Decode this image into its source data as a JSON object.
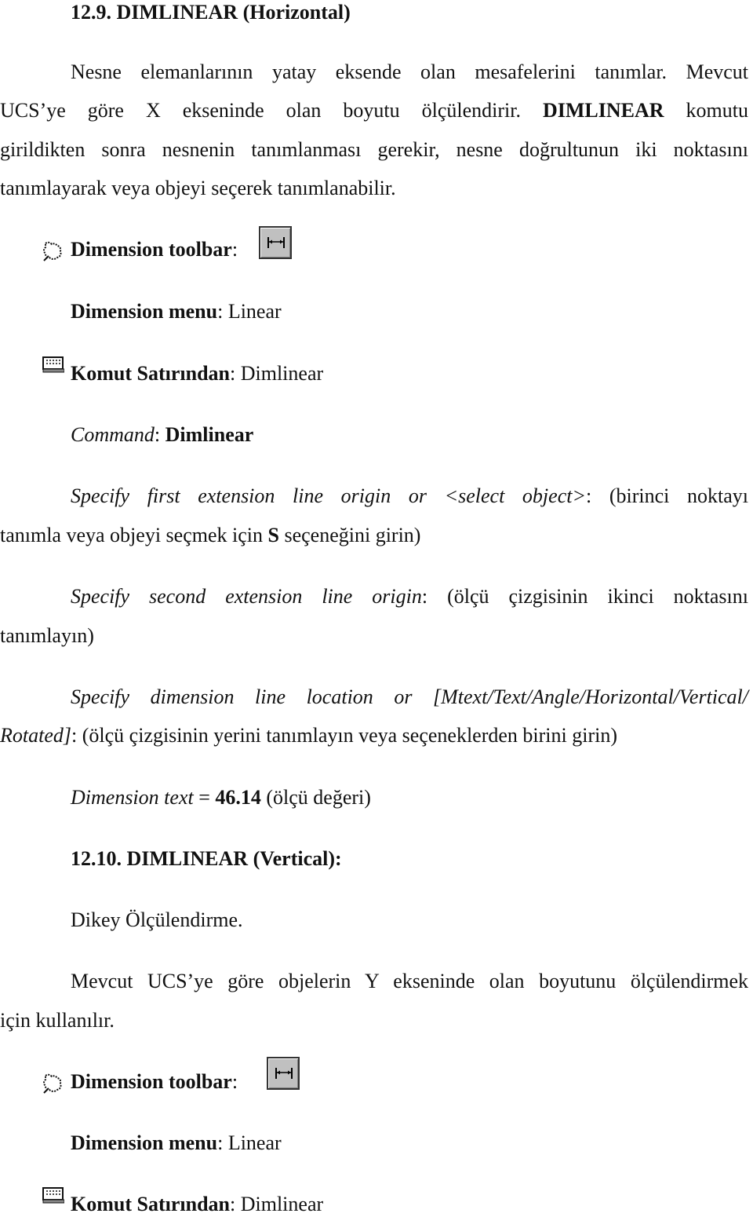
{
  "section1": {
    "heading": "12.9. DIMLINEAR (Horizontal)",
    "para_lines": [
      "Nesne elemanlarının yatay eksende olan mesafelerini tanımlar. Mevcut",
      "UCS’ye göre X ekseninde olan boyutu ölçülendirir. ",
      "DIMLINEAR",
      " komutu",
      "girildikten sonra nesnenin tanımlanması gerekir, nesne doğrultunun iki noktasını",
      "tanımlayarak veya objeyi seçerek tanımlanabilir."
    ],
    "toolbar_label": "Dimension toolbar",
    "menu_label": "Dimension menu",
    "menu_value": "Linear",
    "cmdline_label": "Komut Satırından",
    "cmdline_value": "Dimlinear",
    "command_label": "Command",
    "command_value": "Dimlinear",
    "step1_italic": "Specify first extension line origin or <select object>",
    "step1_rest": "(birinci noktayı",
    "step1_line2a": "tanımla veya objeyi seçmek için ",
    "step1_line2b": "S",
    "step1_line2c": " seçeneğini girin)",
    "step2_italic": "Specify second extension line origin",
    "step2_rest": "(ölçü çizgisinin ikinci noktasını",
    "step2_line2": "tanımlayın)",
    "step3_italic": "Specify dimension line location or [Mtext/Text/Angle/Horizontal/Vertical/",
    "step3_line2_italic": "Rotated]",
    "step3_line2_rest": "(ölçü çizgisinin yerini tanımlayın veya seçeneklerden birini girin)",
    "dimtext_italic": "Dimension text",
    "dimtext_eq": " = ",
    "dimtext_value": "46.14",
    "dimtext_rest": " (ölçü değeri)"
  },
  "section2": {
    "heading": "12.10. DIMLINEAR (Vertical):",
    "subtitle": "Dikey Ölçülendirme.",
    "para_line1": "Mevcut UCS’ye göre objelerin Y ekseninde olan boyutunu ölçülendirmek",
    "para_line2": "için kullanılır.",
    "toolbar_label": "Dimension toolbar",
    "menu_label": "Dimension menu",
    "menu_value": "Linear",
    "cmdline_label": "Komut Satırından",
    "cmdline_value": "Dimlinear"
  },
  "colon": ":",
  "icons": {
    "toolbar": "mouse-pointer-icon",
    "cmdline": "keyboard-icon",
    "button": "dimlinear-button-icon"
  }
}
